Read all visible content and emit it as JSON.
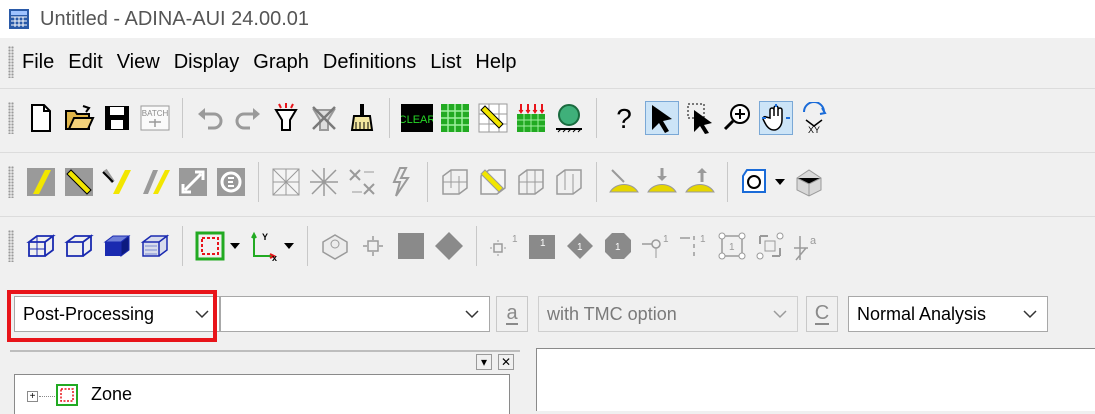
{
  "window": {
    "title": "Untitled - ADINA-AUI  24.00.01"
  },
  "menu": {
    "items": [
      "File",
      "Edit",
      "View",
      "Display",
      "Graph",
      "Definitions",
      "List",
      "Help"
    ]
  },
  "toolbar": {
    "batch_label": "BATCH",
    "clear_label": "CLEAR",
    "help_label": "?"
  },
  "combos": {
    "mode": "Post-Processing",
    "mode_detail": "",
    "option_letter_a": "a",
    "tmc_option": "with TMC option",
    "option_letter_c": "C",
    "analysis_type": "Normal Analysis"
  },
  "tree": {
    "root_item": "Zone"
  },
  "colors": {
    "highlight": "#e8141a",
    "accent_yellow": "#f2e600",
    "green": "#22aa22",
    "pressed_bg": "#cce4f7"
  }
}
